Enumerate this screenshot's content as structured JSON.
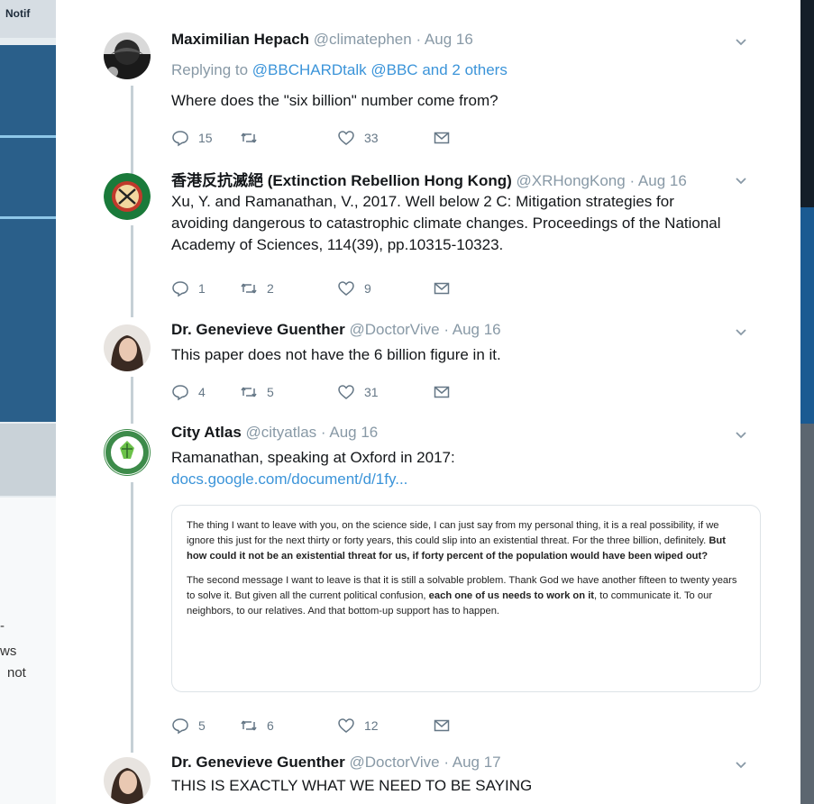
{
  "background": {
    "notif_label": "Notif",
    "frag_ws": "ws",
    "frag_not": "not",
    "frag_dash": "-"
  },
  "thread": [
    {
      "name": "Maximilian Hepach",
      "handle": "@climatephen",
      "date": "· Aug 16",
      "reply_prefix": "Replying to",
      "reply_mentions": "@BBCHARDtalk @BBC",
      "reply_suffix": "and 2 others",
      "text": "Where does the \"six billion\" number come from?",
      "replies": "15",
      "retweets": "",
      "likes": "33"
    },
    {
      "name": "香港反抗滅絕 (Extinction Rebellion Hong Kong)",
      "handle": "@XRHongKong",
      "date": "· Aug 16",
      "text_lines": [
        "Xu, Y. and Ramanathan, V., 2017. Well below 2 C: Mitigation strategies for",
        "avoiding dangerous to catastrophic climate changes. Proceedings of the National",
        "Academy of Sciences, 114(39), pp.10315-10323."
      ],
      "replies": "1",
      "retweets": "2",
      "likes": "9"
    },
    {
      "name": "Dr. Genevieve Guenther",
      "handle": "@DoctorVive",
      "date": "· Aug 16",
      "text": "This paper does not have the 6 billion figure in it.",
      "replies": "4",
      "retweets": "5",
      "likes": "31"
    },
    {
      "name": "City Atlas",
      "handle": "@cityatlas",
      "date": "· Aug 16",
      "text": "Ramanathan, speaking at Oxford in 2017:",
      "link": "docs.google.com/document/d/1fy...",
      "quote": {
        "p1_normal": "The thing I want to leave with you, on the science side, I can just say from my personal thing, it is a real possibility, if we ignore this just for the next thirty or forty years, this could slip into an existential threat. For the three billion, definitely.",
        "p1_bold": "But how could it not be an existential threat for us, if forty percent of the population would have been wiped out?",
        "p2_start": "The second message I want to leave is that it is still a solvable problem. Thank God we have another fifteen to twenty years to solve it. But given all the current political confusion,",
        "p2_bold": "each one of us needs to work on it",
        "p2_end": ", to communicate it. To our neighbors, to our relatives. And that bottom-up support has to happen."
      },
      "replies": "5",
      "retweets": "6",
      "likes": "12"
    },
    {
      "name": "Dr. Genevieve Guenther",
      "handle": "@DoctorVive",
      "date": "· Aug 17",
      "text": "THIS IS EXACTLY WHAT WE NEED TO BE SAYING"
    }
  ],
  "colors": {
    "link": "#3b94d9",
    "muted": "#8899a6",
    "thread_line": "#c6d0d6"
  },
  "icons": [
    "reply-icon",
    "retweet-icon",
    "like-icon",
    "dm-icon",
    "chevron-down-icon"
  ]
}
